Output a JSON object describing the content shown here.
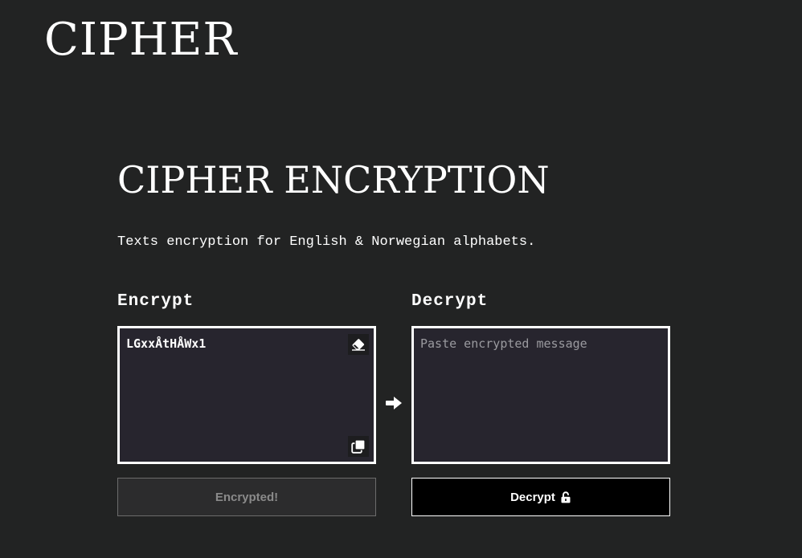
{
  "brand": {
    "logo_text": "CIPHER"
  },
  "hero": {
    "title": "CIPHER ENCRYPTION",
    "subtitle": "Texts encryption for English & Norwegian alphabets."
  },
  "encrypt": {
    "heading": "Encrypt",
    "value": "LGxxÅtHÅWx1",
    "clear_icon": "eraser-icon",
    "copy_icon": "copy-icon",
    "button_label": "Encrypted!"
  },
  "arrow_icon": "arrow-right-icon",
  "decrypt": {
    "heading": "Decrypt",
    "value": "",
    "placeholder": "Paste encrypted message",
    "button_label": "Decrypt",
    "button_icon": "lock-open-icon"
  },
  "colors": {
    "background": "#222323",
    "panel": "#27252e",
    "text": "#ffffff",
    "disabled_text": "#8a8a8a",
    "decrypt_button": "#000000"
  }
}
